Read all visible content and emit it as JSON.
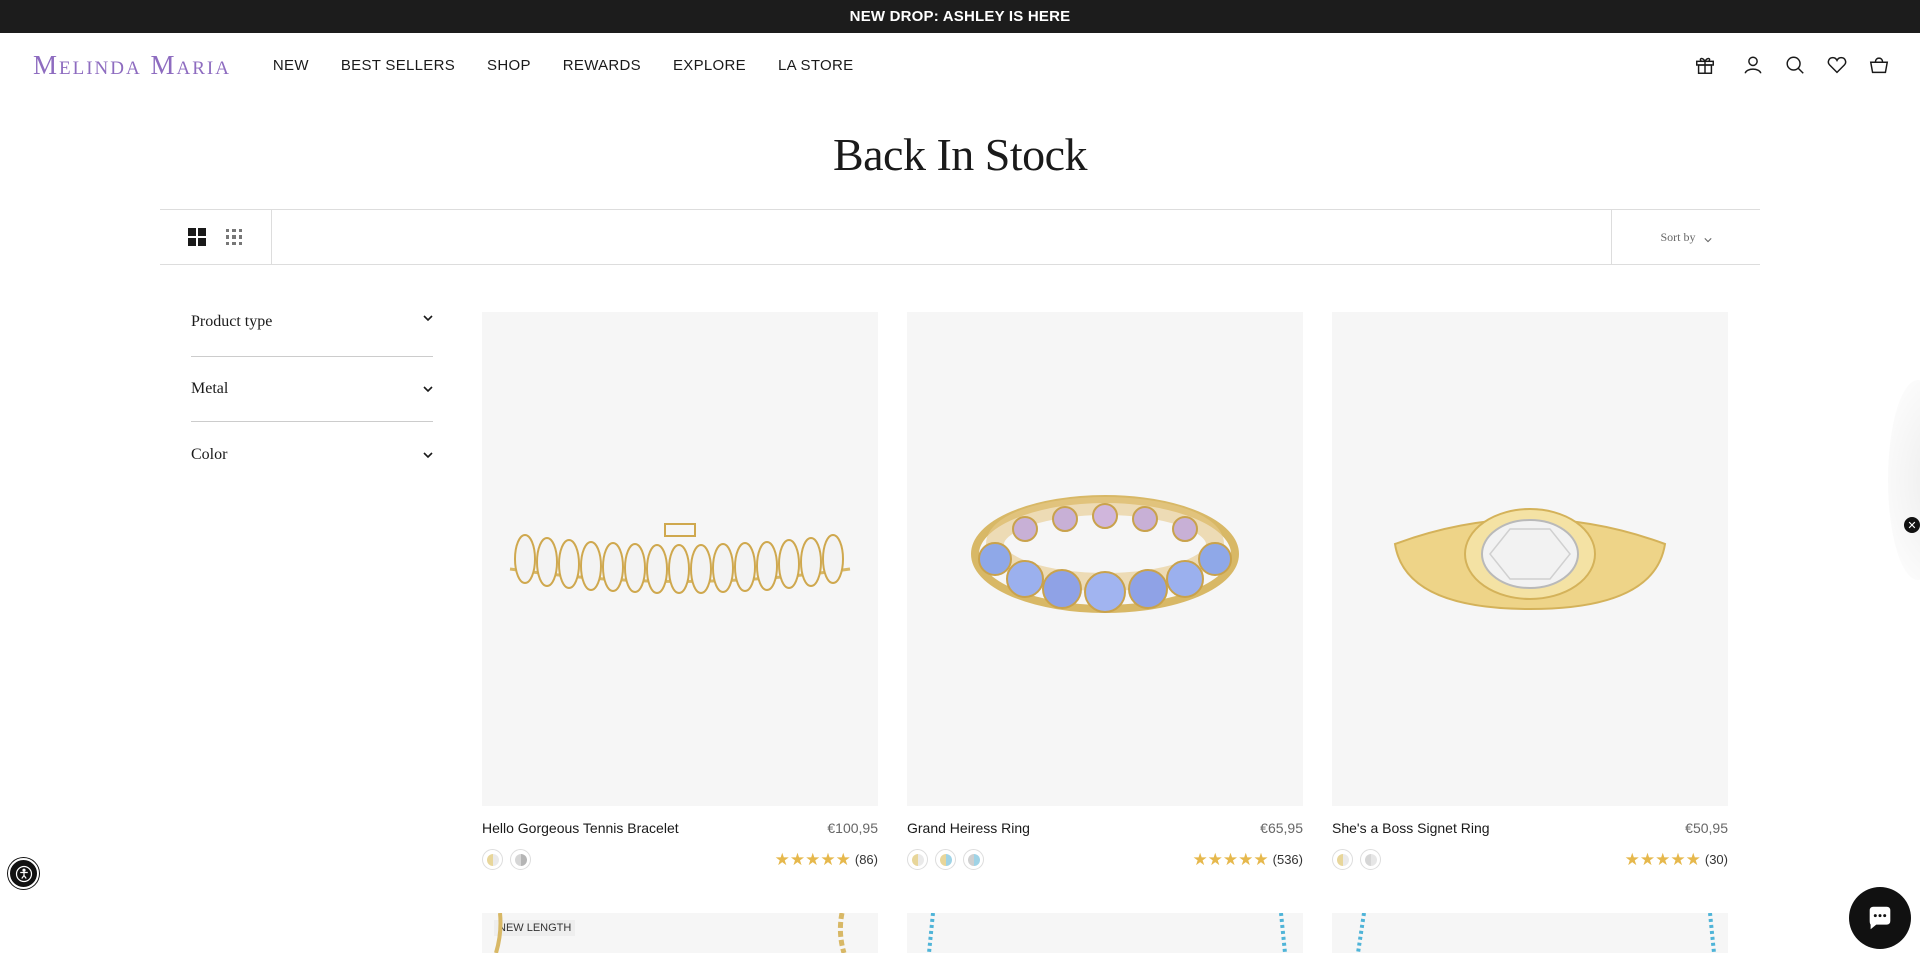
{
  "announcement": "NEW DROP: ASHLEY IS HERE",
  "header": {
    "logo": "Melinda Maria",
    "nav": [
      "NEW",
      "BEST SELLERS",
      "SHOP",
      "REWARDS",
      "EXPLORE",
      "LA STORE"
    ],
    "icons": [
      "gift-icon",
      "account-icon",
      "search-icon",
      "wishlist-icon",
      "cart-icon"
    ]
  },
  "page": {
    "title": "Back In Stock"
  },
  "toolbar": {
    "sort_label": "Sort by"
  },
  "filters": [
    "Product type",
    "Metal",
    "Color"
  ],
  "products": [
    {
      "name": "Hello Gorgeous Tennis Bracelet",
      "price": "€100,95",
      "reviews": "(86)",
      "rating": 5,
      "swatch_colors": [
        [
          "#e8d69a",
          "#e0e0e0"
        ],
        [
          "#d9d9d9",
          "#bdbdbd"
        ]
      ]
    },
    {
      "name": "Grand Heiress Ring",
      "price": "€65,95",
      "reviews": "(536)",
      "rating": 5,
      "swatch_colors": [
        [
          "#e8d69a",
          "#e0e0e0"
        ],
        [
          "#e8d69a",
          "#9fd3e6"
        ],
        [
          "#cfcfcf",
          "#9fd3e6"
        ]
      ]
    },
    {
      "name": "She's a Boss Signet Ring",
      "price": "€50,95",
      "reviews": "(30)",
      "rating": 5,
      "swatch_colors": [
        [
          "#e8d69a",
          "#e0e0e0"
        ],
        [
          "#d9d9d9",
          "#bdbdbd"
        ]
      ]
    }
  ],
  "row2": {
    "badge": "NEW LENGTH"
  },
  "colors": {
    "announcement_bg": "#1c1c1c",
    "logo": "#8e6cc0",
    "star": "#e6b84c",
    "card_bg": "#f6f6f6"
  }
}
